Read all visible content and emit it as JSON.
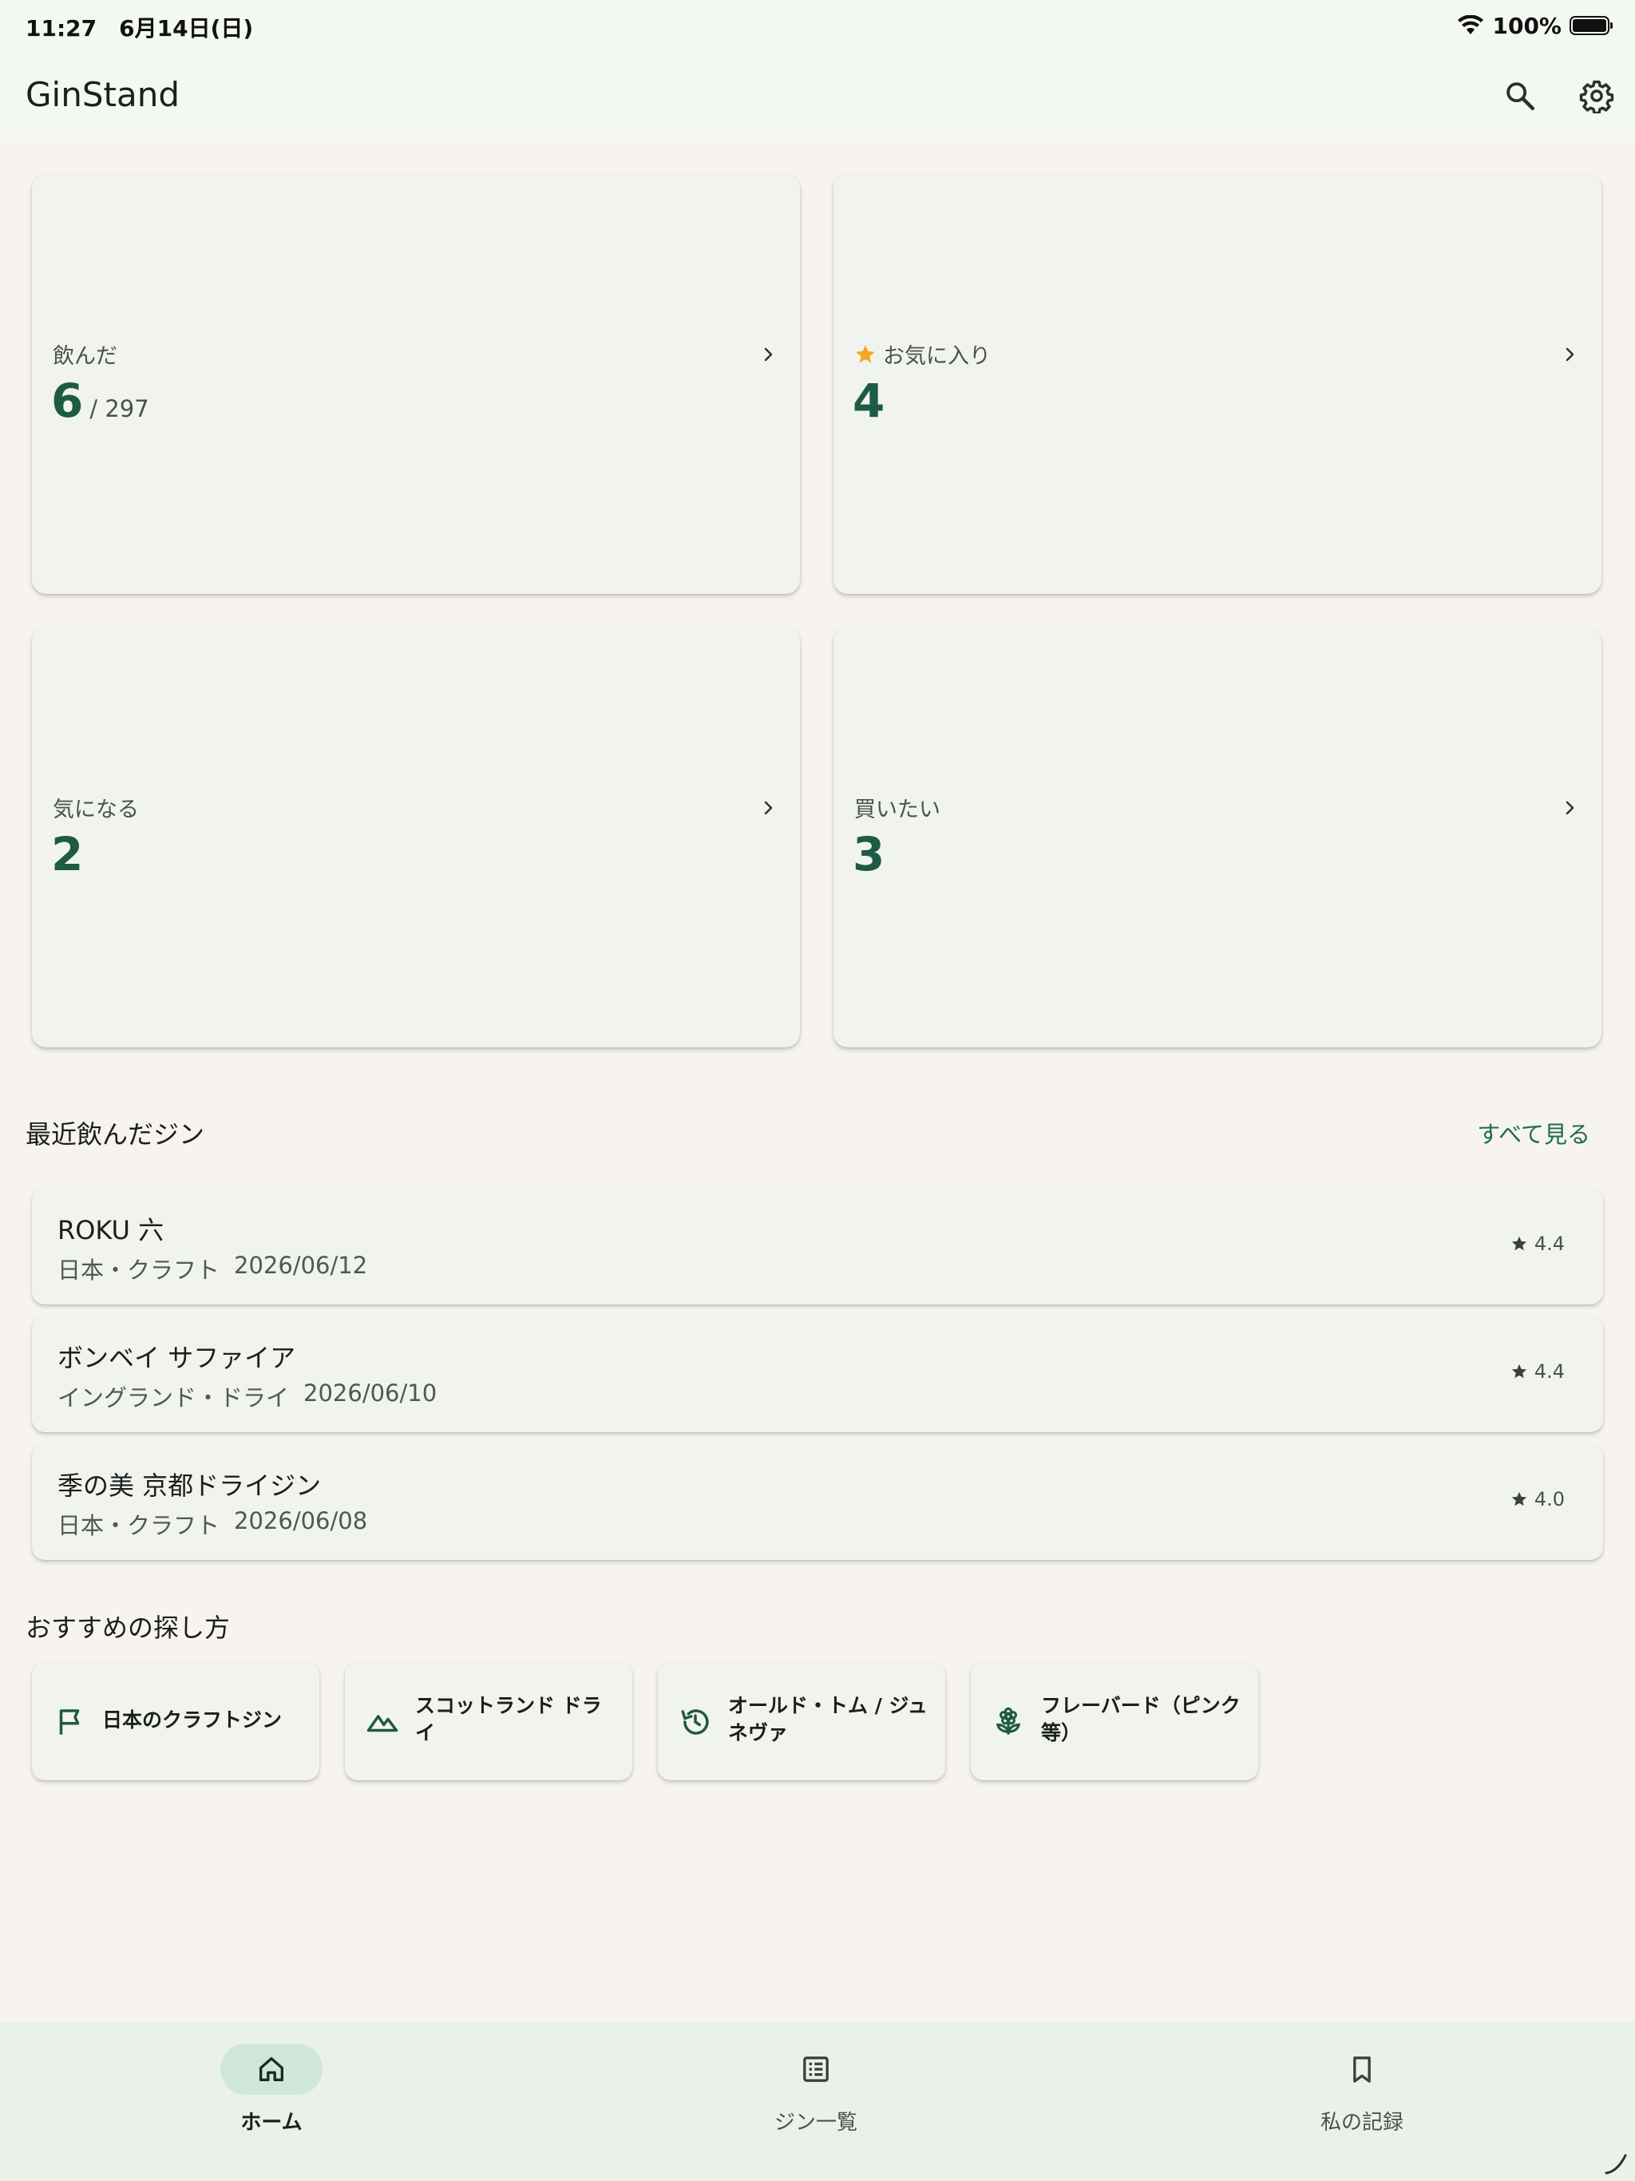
{
  "status_bar": {
    "time_date": "11:27　6月14日(日)",
    "battery": "100%",
    "wifi_icon": "wifi-icon",
    "battery_icon": "battery-icon"
  },
  "app_bar": {
    "title": "GinStand",
    "search_icon": "search-icon",
    "settings_icon": "gear-icon"
  },
  "stats": [
    {
      "label": "飲んだ",
      "value": "6",
      "total": "/ 297"
    },
    {
      "label": "お気に入り",
      "value": "4",
      "icon": "star-icon",
      "icon_color": "#f5a623"
    },
    {
      "label": "気になる",
      "value": "2"
    },
    {
      "label": "買いたい",
      "value": "3"
    }
  ],
  "recent": {
    "title": "最近飲んだジン",
    "see_all": "すべて見る",
    "items": [
      {
        "name": "ROKU 六",
        "category": "日本・クラフト",
        "date": "2026/06/12",
        "rating": "4.4"
      },
      {
        "name": "ボンベイ サファイア",
        "category": "イングランド・ドライ",
        "date": "2026/06/10",
        "rating": "4.4"
      },
      {
        "name": "季の美 京都ドライジン",
        "category": "日本・クラフト",
        "date": "2026/06/08",
        "rating": "4.0"
      }
    ]
  },
  "recommend": {
    "title": "おすすめの探し方",
    "items": [
      {
        "label": "日本のクラフトジン",
        "icon": "flag-icon"
      },
      {
        "label": "スコットランド ドライ",
        "icon": "landscape-icon"
      },
      {
        "label": "オールド・トム / ジュネヴァ",
        "icon": "history-icon"
      },
      {
        "label": "フレーバード（ピンク等）",
        "icon": "flower-icon"
      }
    ]
  },
  "bottom_nav": {
    "items": [
      {
        "label": "ホーム",
        "icon": "home-icon",
        "active": true
      },
      {
        "label": "ジン一覧",
        "icon": "list-icon",
        "active": false
      },
      {
        "label": "私の記録",
        "icon": "bookmark-icon",
        "active": false
      }
    ]
  },
  "colors": {
    "accent": "#1e5a44",
    "link": "#1e6b4d",
    "star": "#f5a623",
    "background": "#f7f4ef",
    "card": "#f1f3ef"
  }
}
